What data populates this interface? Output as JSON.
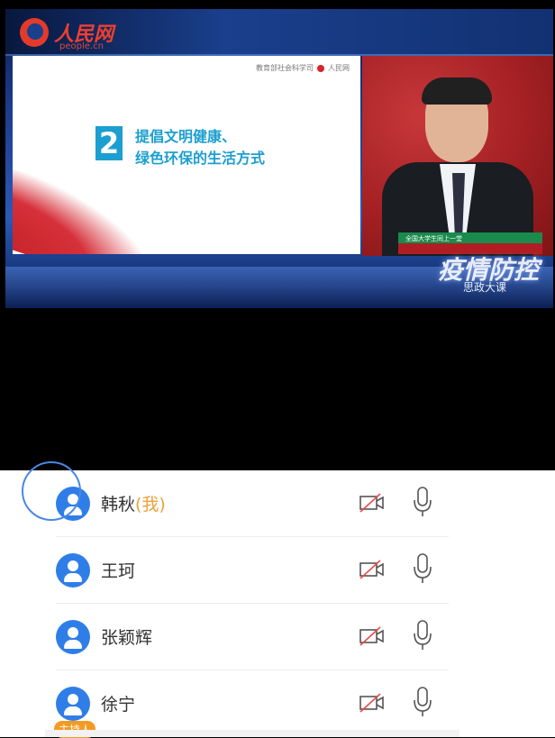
{
  "broadcast": {
    "logo_text": "人民网",
    "logo_sub": "people.cn",
    "slide": {
      "header_text": "教育部社会科学司",
      "header_brand": "人民网",
      "number": "2",
      "title_line1": "提倡文明健康、",
      "title_line2": "绿色环保的生活方式"
    },
    "presenter_caption": "全国大学生同上一堂",
    "banner_title": "疫情防控",
    "banner_subtitle": "思政大课"
  },
  "participants": [
    {
      "name": "韩秋",
      "suffix": "(我)",
      "badge": ""
    },
    {
      "name": "王珂",
      "suffix": "",
      "badge": ""
    },
    {
      "name": "张颖辉",
      "suffix": "",
      "badge": ""
    },
    {
      "name": "徐宁",
      "suffix": "",
      "badge": "主持人"
    }
  ],
  "icons": {
    "avatar": "user-avatar-icon",
    "camera": "camera-off-icon",
    "microphone": "microphone-icon"
  },
  "colors": {
    "avatar_blue": "#2f7ee8",
    "self_tag": "#e9a23b",
    "host_badge": "#f29b23",
    "camera_off_slash": "#e84b4b"
  }
}
